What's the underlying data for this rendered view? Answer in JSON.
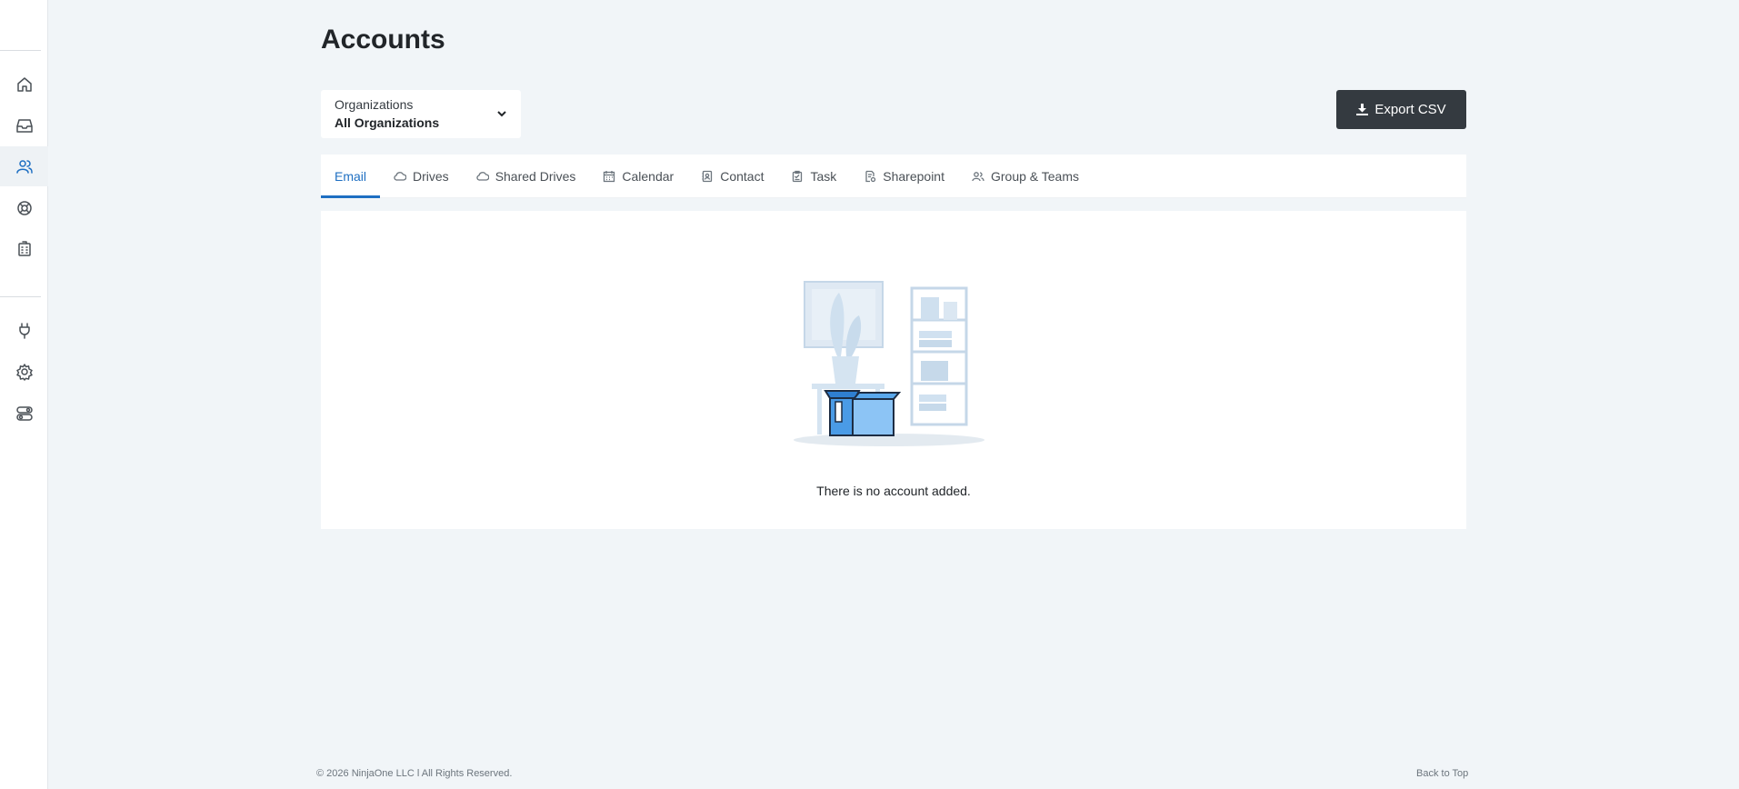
{
  "page": {
    "title": "Accounts"
  },
  "sidebar": {
    "items": [
      {
        "name": "home-icon",
        "active": false
      },
      {
        "name": "inbox-icon",
        "active": false
      },
      {
        "name": "users-icon",
        "active": true
      },
      {
        "name": "support-icon",
        "active": false
      },
      {
        "name": "building-icon",
        "active": false
      },
      {
        "name": "plug-icon",
        "active": false
      },
      {
        "name": "gear-icon",
        "active": false
      },
      {
        "name": "toggle-icon",
        "active": false
      }
    ]
  },
  "filter": {
    "label": "Organizations",
    "value": "All Organizations"
  },
  "export": {
    "label": "Export CSV"
  },
  "tabs": [
    {
      "label": "Email",
      "active": true
    },
    {
      "label": "Drives",
      "icon": "cloud-icon"
    },
    {
      "label": "Shared Drives",
      "icon": "cloud-icon"
    },
    {
      "label": "Calendar",
      "icon": "calendar-icon"
    },
    {
      "label": "Contact",
      "icon": "contact-icon"
    },
    {
      "label": "Task",
      "icon": "task-icon"
    },
    {
      "label": "Sharepoint",
      "icon": "sharepoint-icon"
    },
    {
      "label": "Group & Teams",
      "icon": "group-icon"
    }
  ],
  "empty": {
    "message": "There is no account added."
  },
  "footer": {
    "copyright": "© 2026 NinjaOne LLC l All Rights Reserved.",
    "back_to_top": "Back to Top"
  },
  "colors": {
    "accent": "#1e6fc2",
    "dark_button": "#343a40",
    "background": "#f1f5f8"
  }
}
